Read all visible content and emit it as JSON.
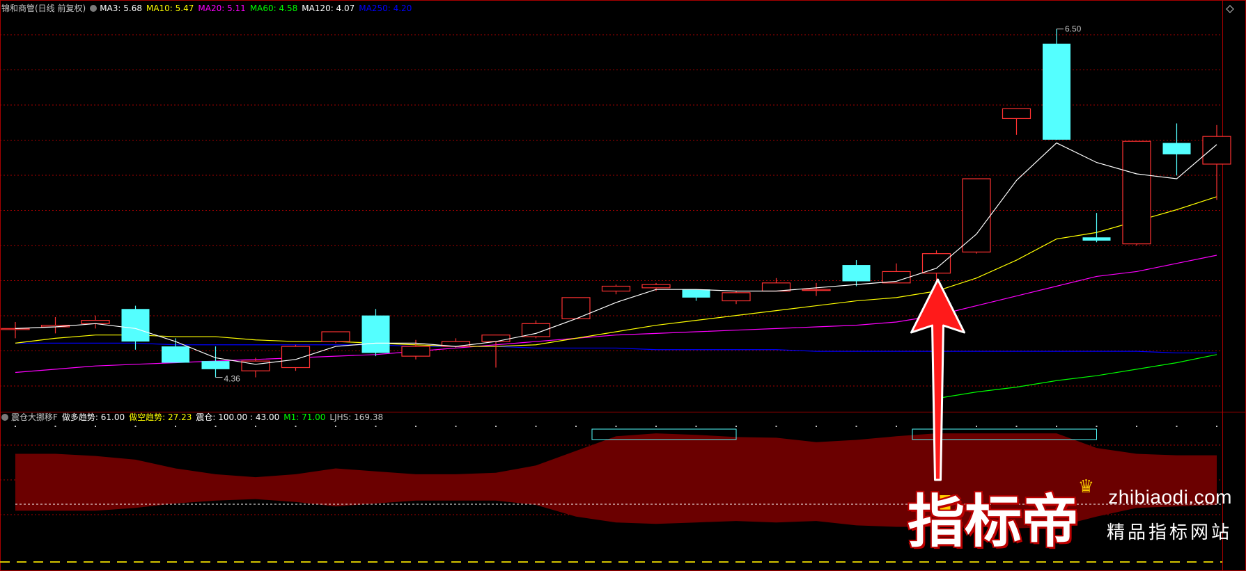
{
  "header": {
    "stock": "锦和商管(日线 前复权)",
    "ma": [
      {
        "label": "MA3: 5.68",
        "color": "#ffffff"
      },
      {
        "label": "MA10: 5.47",
        "color": "#ffff00"
      },
      {
        "label": "MA20: 5.11",
        "color": "#ff00ff"
      },
      {
        "label": "MA60: 4.58",
        "color": "#00ff00"
      },
      {
        "label": "MA120: 4.07",
        "color": "#ffffff"
      },
      {
        "label": "MA250: 4.20",
        "color": "#0000ff"
      }
    ]
  },
  "subheader": {
    "name": "震仓大挪移F",
    "items": [
      {
        "label": "做多趋势: 61.00",
        "color": "#ffffff"
      },
      {
        "label": "做空趋势: 27.23",
        "color": "#ffff00"
      },
      {
        "label": "震仓: 100.00 : 43.00",
        "color": "#ffffff"
      },
      {
        "label": "M1: 71.00",
        "color": "#00ff00"
      },
      {
        "label": "LJHS: 169.38",
        "color": "#c8c8c8"
      }
    ]
  },
  "colors": {
    "up": "#ff3232",
    "down": "#54ffff",
    "ma3": "#ffffff",
    "ma10": "#ffff00",
    "ma20": "#ff00ff",
    "ma60": "#00ff00",
    "ma250": "#0000ff",
    "band": "#6b0000",
    "grid": "#a80000",
    "arrow": "#ff1a1a"
  },
  "chart_data": {
    "type": "candlestick",
    "y_range": [
      4.2,
      6.55
    ],
    "high_label": "6.50",
    "low_label": "4.36",
    "candles": [
      {
        "o": 4.66,
        "h": 4.7,
        "l": 4.6,
        "c": 4.66
      },
      {
        "o": 4.67,
        "h": 4.73,
        "l": 4.63,
        "c": 4.68
      },
      {
        "o": 4.69,
        "h": 4.74,
        "l": 4.66,
        "c": 4.71
      },
      {
        "o": 4.78,
        "h": 4.8,
        "l": 4.53,
        "c": 4.58
      },
      {
        "o": 4.55,
        "h": 4.6,
        "l": 4.45,
        "c": 4.45
      },
      {
        "o": 4.46,
        "h": 4.55,
        "l": 4.36,
        "c": 4.41
      },
      {
        "o": 4.4,
        "h": 4.48,
        "l": 4.36,
        "c": 4.46
      },
      {
        "o": 4.42,
        "h": 4.56,
        "l": 4.4,
        "c": 4.55
      },
      {
        "o": 4.58,
        "h": 4.64,
        "l": 4.57,
        "c": 4.64
      },
      {
        "o": 4.74,
        "h": 4.78,
        "l": 4.49,
        "c": 4.51
      },
      {
        "o": 4.49,
        "h": 4.59,
        "l": 4.47,
        "c": 4.55
      },
      {
        "o": 4.55,
        "h": 4.6,
        "l": 4.54,
        "c": 4.58
      },
      {
        "o": 4.58,
        "h": 4.6,
        "l": 4.42,
        "c": 4.62
      },
      {
        "o": 4.61,
        "h": 4.71,
        "l": 4.6,
        "c": 4.69
      },
      {
        "o": 4.72,
        "h": 4.85,
        "l": 4.72,
        "c": 4.85
      },
      {
        "o": 4.89,
        "h": 4.93,
        "l": 4.87,
        "c": 4.92
      },
      {
        "o": 4.91,
        "h": 4.94,
        "l": 4.89,
        "c": 4.93
      },
      {
        "o": 4.9,
        "h": 4.9,
        "l": 4.83,
        "c": 4.85
      },
      {
        "o": 4.83,
        "h": 4.89,
        "l": 4.81,
        "c": 4.88
      },
      {
        "o": 4.89,
        "h": 4.97,
        "l": 4.89,
        "c": 4.94
      },
      {
        "o": 4.9,
        "h": 4.94,
        "l": 4.86,
        "c": 4.9
      },
      {
        "o": 5.05,
        "h": 5.08,
        "l": 4.92,
        "c": 4.95
      },
      {
        "o": 4.94,
        "h": 5.06,
        "l": 4.94,
        "c": 5.01
      },
      {
        "o": 5.0,
        "h": 5.14,
        "l": 4.95,
        "c": 5.12
      },
      {
        "o": 5.13,
        "h": 5.58,
        "l": 5.12,
        "c": 5.58
      },
      {
        "o": 5.95,
        "h": 6.01,
        "l": 5.85,
        "c": 6.01
      },
      {
        "o": 6.41,
        "h": 6.5,
        "l": 5.82,
        "c": 5.82
      },
      {
        "o": 5.22,
        "h": 5.37,
        "l": 5.19,
        "c": 5.2
      },
      {
        "o": 5.18,
        "h": 5.81,
        "l": 5.17,
        "c": 5.81
      },
      {
        "o": 5.8,
        "h": 5.92,
        "l": 5.6,
        "c": 5.73
      },
      {
        "o": 5.67,
        "h": 5.91,
        "l": 5.45,
        "c": 5.84
      }
    ],
    "ma3": [
      4.66,
      4.67,
      4.69,
      4.66,
      4.58,
      4.48,
      4.44,
      4.47,
      4.55,
      4.57,
      4.57,
      4.55,
      4.58,
      4.63,
      4.72,
      4.82,
      4.9,
      4.9,
      4.89,
      4.89,
      4.91,
      4.93,
      4.95,
      5.03,
      5.24,
      5.57,
      5.8,
      5.68,
      5.61,
      5.58,
      5.79
    ],
    "ma10": [
      4.57,
      4.6,
      4.62,
      4.62,
      4.61,
      4.61,
      4.59,
      4.58,
      4.58,
      4.57,
      4.56,
      4.55,
      4.55,
      4.56,
      4.6,
      4.64,
      4.68,
      4.71,
      4.74,
      4.77,
      4.8,
      4.83,
      4.85,
      4.89,
      4.97,
      5.08,
      5.21,
      5.25,
      5.32,
      5.39,
      5.47
    ],
    "ma20": [
      4.39,
      4.41,
      4.43,
      4.44,
      4.45,
      4.46,
      4.47,
      4.48,
      4.49,
      4.5,
      4.52,
      4.54,
      4.56,
      4.58,
      4.6,
      4.62,
      4.63,
      4.64,
      4.65,
      4.66,
      4.67,
      4.68,
      4.7,
      4.74,
      4.8,
      4.86,
      4.92,
      4.98,
      5.01,
      5.06,
      5.11
    ],
    "ma60": [
      null,
      null,
      null,
      null,
      null,
      null,
      null,
      null,
      null,
      null,
      null,
      null,
      null,
      null,
      null,
      null,
      null,
      null,
      null,
      null,
      null,
      null,
      null,
      4.23,
      4.27,
      4.3,
      4.34,
      4.37,
      4.41,
      4.45,
      4.5
    ],
    "ma250": [
      4.57,
      4.57,
      4.57,
      4.57,
      4.56,
      4.56,
      4.56,
      4.56,
      4.56,
      4.56,
      4.55,
      4.55,
      4.55,
      4.54,
      4.54,
      4.54,
      4.53,
      4.53,
      4.53,
      4.53,
      4.52,
      4.52,
      4.52,
      4.52,
      4.52,
      4.52,
      4.52,
      4.52,
      4.52,
      4.51,
      4.51
    ],
    "indicator": {
      "band_top": [
        0.5,
        0.5,
        0.53,
        0.58,
        0.7,
        0.78,
        0.82,
        0.78,
        0.7,
        0.74,
        0.78,
        0.78,
        0.76,
        0.66,
        0.46,
        0.26,
        0.22,
        0.24,
        0.27,
        0.28,
        0.34,
        0.31,
        0.26,
        0.22,
        0.22,
        0.22,
        0.22,
        0.42,
        0.5,
        0.52,
        0.52
      ],
      "band_bottom": [
        1.28,
        1.28,
        1.28,
        1.24,
        1.18,
        1.14,
        1.12,
        1.16,
        1.22,
        1.18,
        1.14,
        1.14,
        1.14,
        1.2,
        1.36,
        1.44,
        1.46,
        1.44,
        1.42,
        1.44,
        1.42,
        1.48,
        1.5,
        1.5,
        1.5,
        1.52,
        1.5,
        1.36,
        1.24,
        1.22,
        1.2
      ],
      "boxes": [
        {
          "from": 14.4,
          "to": 18.0
        },
        {
          "from": 22.4,
          "to": 27.0
        }
      ],
      "signal_index": 23
    }
  },
  "watermark": {
    "brand": "指标帝",
    "site": "zhibiaodi.com",
    "tagline": "精品指标网站"
  }
}
